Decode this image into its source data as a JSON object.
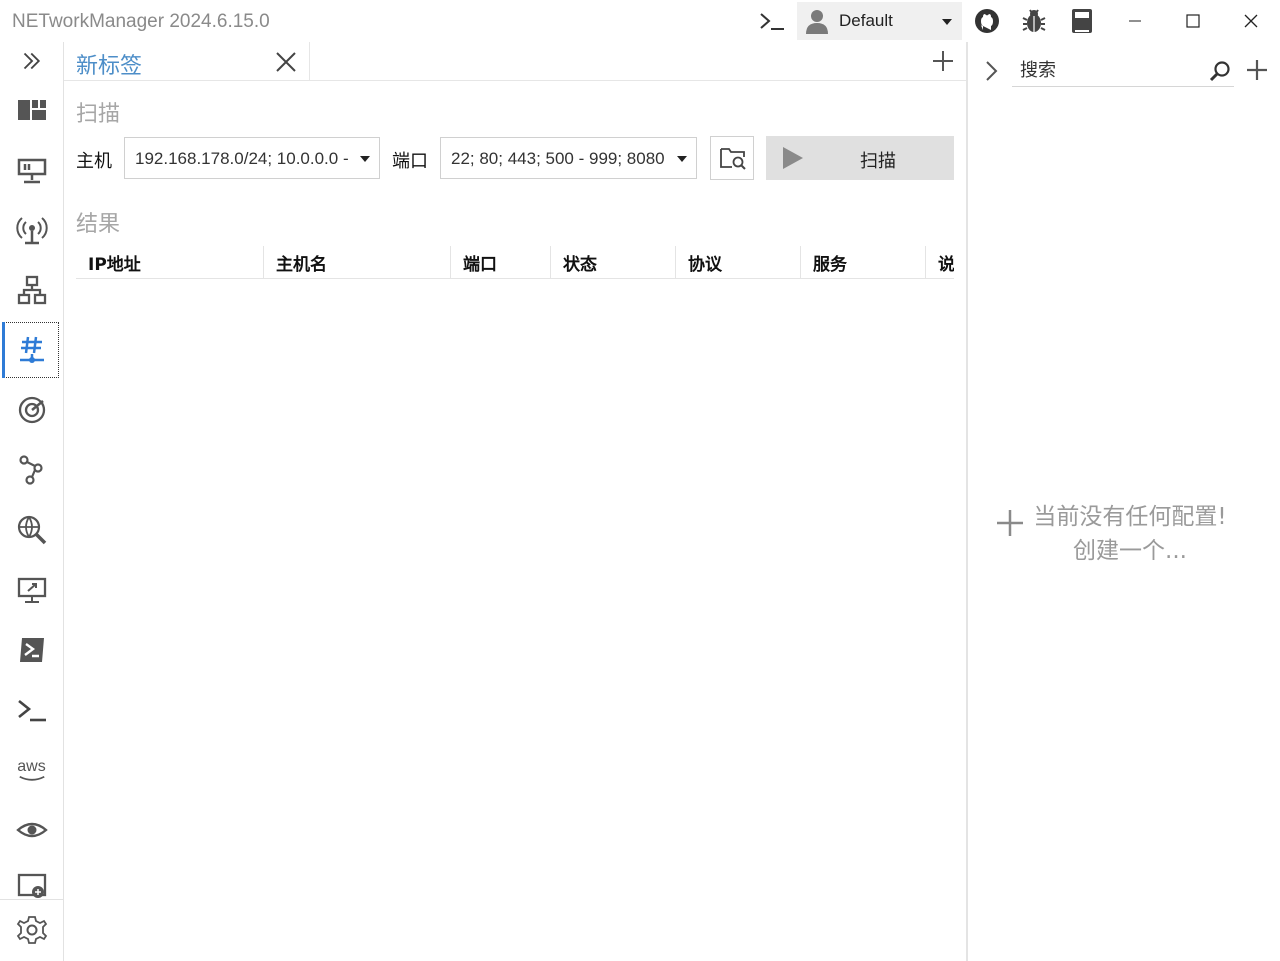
{
  "app": {
    "title": "NETworkManager 2024.6.15.0"
  },
  "titlebar": {
    "profile": "Default",
    "icons": [
      "terminal-icon",
      "user-icon",
      "github-icon",
      "bug-icon",
      "book-icon",
      "minimize-icon",
      "maximize-icon",
      "close-icon"
    ]
  },
  "nav": {
    "icons": [
      "expand-icon",
      "dashboard-icon",
      "network-interface-icon",
      "wifi-icon",
      "ip-scanner-icon",
      "port-scanner-icon",
      "ping-monitor-icon",
      "traceroute-icon",
      "dns-lookup-icon",
      "remote-desktop-icon",
      "powershell-icon",
      "putty-icon",
      "aws-icon",
      "visual-icon",
      "web-console-icon",
      "settings-icon"
    ],
    "aws_text": "aws",
    "active": "port-scanner-icon"
  },
  "tabs": {
    "items": [
      {
        "label": "新标签"
      }
    ]
  },
  "scan": {
    "section_title": "扫描",
    "host_label": "主机",
    "host_value": "192.168.178.0/24; 10.0.0.0 -",
    "port_label": "端口",
    "port_value": "22; 80; 443; 500 - 999; 8080",
    "scan_button": "扫描"
  },
  "results": {
    "section_title": "结果",
    "columns": [
      "IP地址",
      "主机名",
      "端口",
      "状态",
      "协议",
      "服务",
      "说"
    ]
  },
  "profiles": {
    "search_placeholder": "搜索",
    "empty_line1": "当前没有任何配置!",
    "empty_line2": "创建一个..."
  }
}
